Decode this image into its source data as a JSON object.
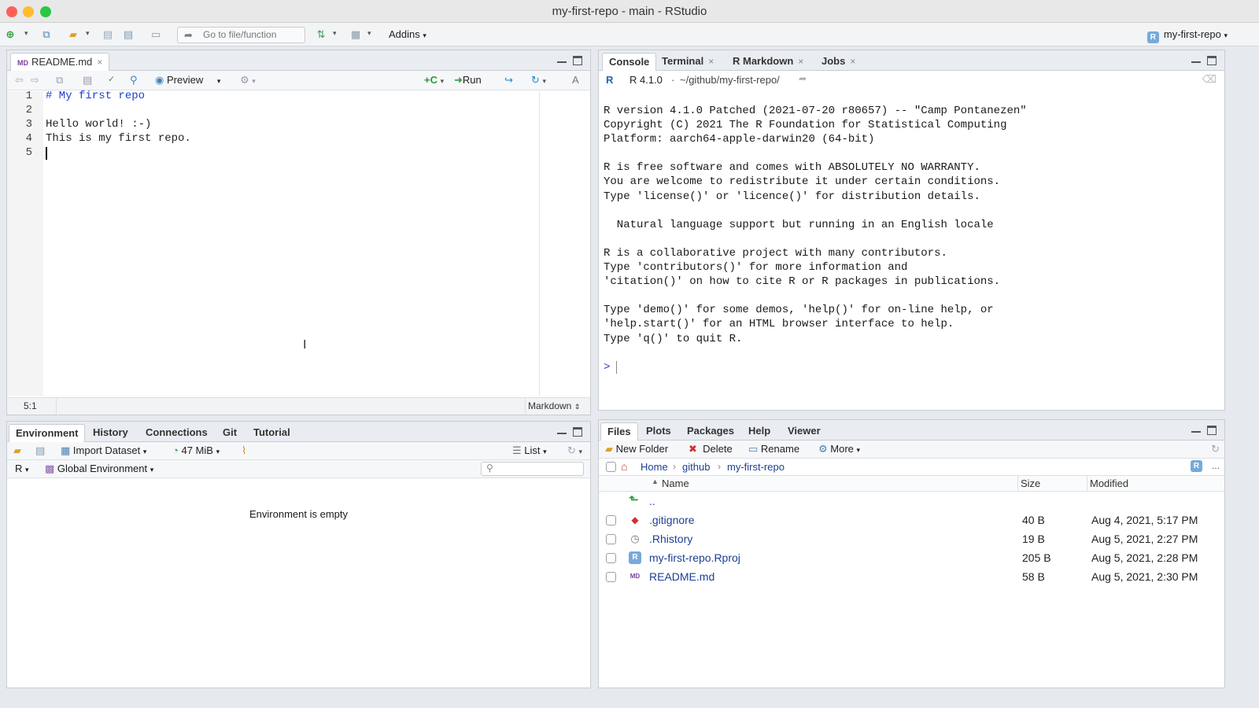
{
  "window": {
    "title": "my-first-repo - main - RStudio"
  },
  "toolbar": {
    "goto_placeholder": "Go to file/function",
    "addins_label": "Addins",
    "project_label": "my-first-repo"
  },
  "source": {
    "tab_label": "README.md",
    "tab_badge": "MD",
    "preview_label": "Preview",
    "run_label": "Run",
    "lines": [
      "# My first repo",
      "",
      "Hello world! :-)",
      "This is my first repo.",
      ""
    ],
    "line_numbers": [
      "1",
      "2",
      "3",
      "4",
      "5"
    ],
    "cursor_pos": "5:1",
    "file_type": "Markdown"
  },
  "console_pane": {
    "tabs": [
      "Console",
      "Terminal",
      "R Markdown",
      "Jobs"
    ],
    "r_version": "R 4.1.0",
    "path": "~/github/my-first-repo/",
    "output": "R version 4.1.0 Patched (2021-07-20 r80657) -- \"Camp Pontanezen\"\nCopyright (C) 2021 The R Foundation for Statistical Computing\nPlatform: aarch64-apple-darwin20 (64-bit)\n\nR is free software and comes with ABSOLUTELY NO WARRANTY.\nYou are welcome to redistribute it under certain conditions.\nType 'license()' or 'licence()' for distribution details.\n\n  Natural language support but running in an English locale\n\nR is a collaborative project with many contributors.\nType 'contributors()' for more information and\n'citation()' on how to cite R or R packages in publications.\n\nType 'demo()' for some demos, 'help()' for on-line help, or\n'help.start()' for an HTML browser interface to help.\nType 'q()' to quit R.",
    "prompt": ">"
  },
  "env_pane": {
    "tabs": [
      "Environment",
      "History",
      "Connections",
      "Git",
      "Tutorial"
    ],
    "import_label": "Import Dataset",
    "memory_label": "47 MiB",
    "list_label": "List",
    "lang_label": "R",
    "scope_label": "Global Environment",
    "empty_message": "Environment is empty"
  },
  "files_pane": {
    "tabs": [
      "Files",
      "Plots",
      "Packages",
      "Help",
      "Viewer"
    ],
    "new_folder_label": "New Folder",
    "delete_label": "Delete",
    "rename_label": "Rename",
    "more_label": "More",
    "breadcrumb": [
      "Home",
      "github",
      "my-first-repo"
    ],
    "more_dots": "...",
    "columns": {
      "name": "Name",
      "size": "Size",
      "modified": "Modified"
    },
    "parent_label": "..",
    "files": [
      {
        "name": ".gitignore",
        "size": "40 B",
        "modified": "Aug 4, 2021, 5:17 PM",
        "icon": "gitignore-file-icon"
      },
      {
        "name": ".Rhistory",
        "size": "19 B",
        "modified": "Aug 5, 2021, 2:27 PM",
        "icon": "history-file-icon"
      },
      {
        "name": "my-first-repo.Rproj",
        "size": "205 B",
        "modified": "Aug 5, 2021, 2:28 PM",
        "icon": "rproj-file-icon"
      },
      {
        "name": "README.md",
        "size": "58 B",
        "modified": "Aug 5, 2021, 2:30 PM",
        "icon": "markdown-file-icon"
      }
    ]
  },
  "colors": {
    "accent": "#4a7fb5",
    "link": "#1c3f94",
    "md_comment": "#1c3fd0"
  }
}
